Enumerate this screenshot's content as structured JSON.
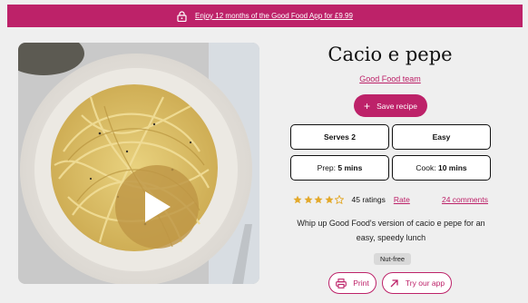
{
  "promo": {
    "text": "Enjoy 12 months of the Good Food App for £9.99"
  },
  "recipe": {
    "title": "Cacio e pepe",
    "author": "Good Food team",
    "save_label": "Save recipe",
    "serves": "Serves 2",
    "difficulty": "Easy",
    "prep_label": "Prep:",
    "prep_value": "5 mins",
    "cook_label": "Cook:",
    "cook_value": "10 mins",
    "rating": {
      "value": 4,
      "max": 5,
      "ratings_text": "45 ratings"
    },
    "rate_label": "Rate",
    "comments_label": "24 comments",
    "description": "Whip up Good Food's version of cacio e pepe for an easy, speedy lunch",
    "tag": "Nut-free",
    "print_label": "Print",
    "app_label": "Try our app"
  },
  "colors": {
    "accent": "#bd2269",
    "star": "#e3a92b",
    "background": "#efefef"
  },
  "icons": [
    "lock-icon",
    "play-icon",
    "plus-icon",
    "star-icon",
    "printer-icon",
    "external-arrow-icon"
  ]
}
